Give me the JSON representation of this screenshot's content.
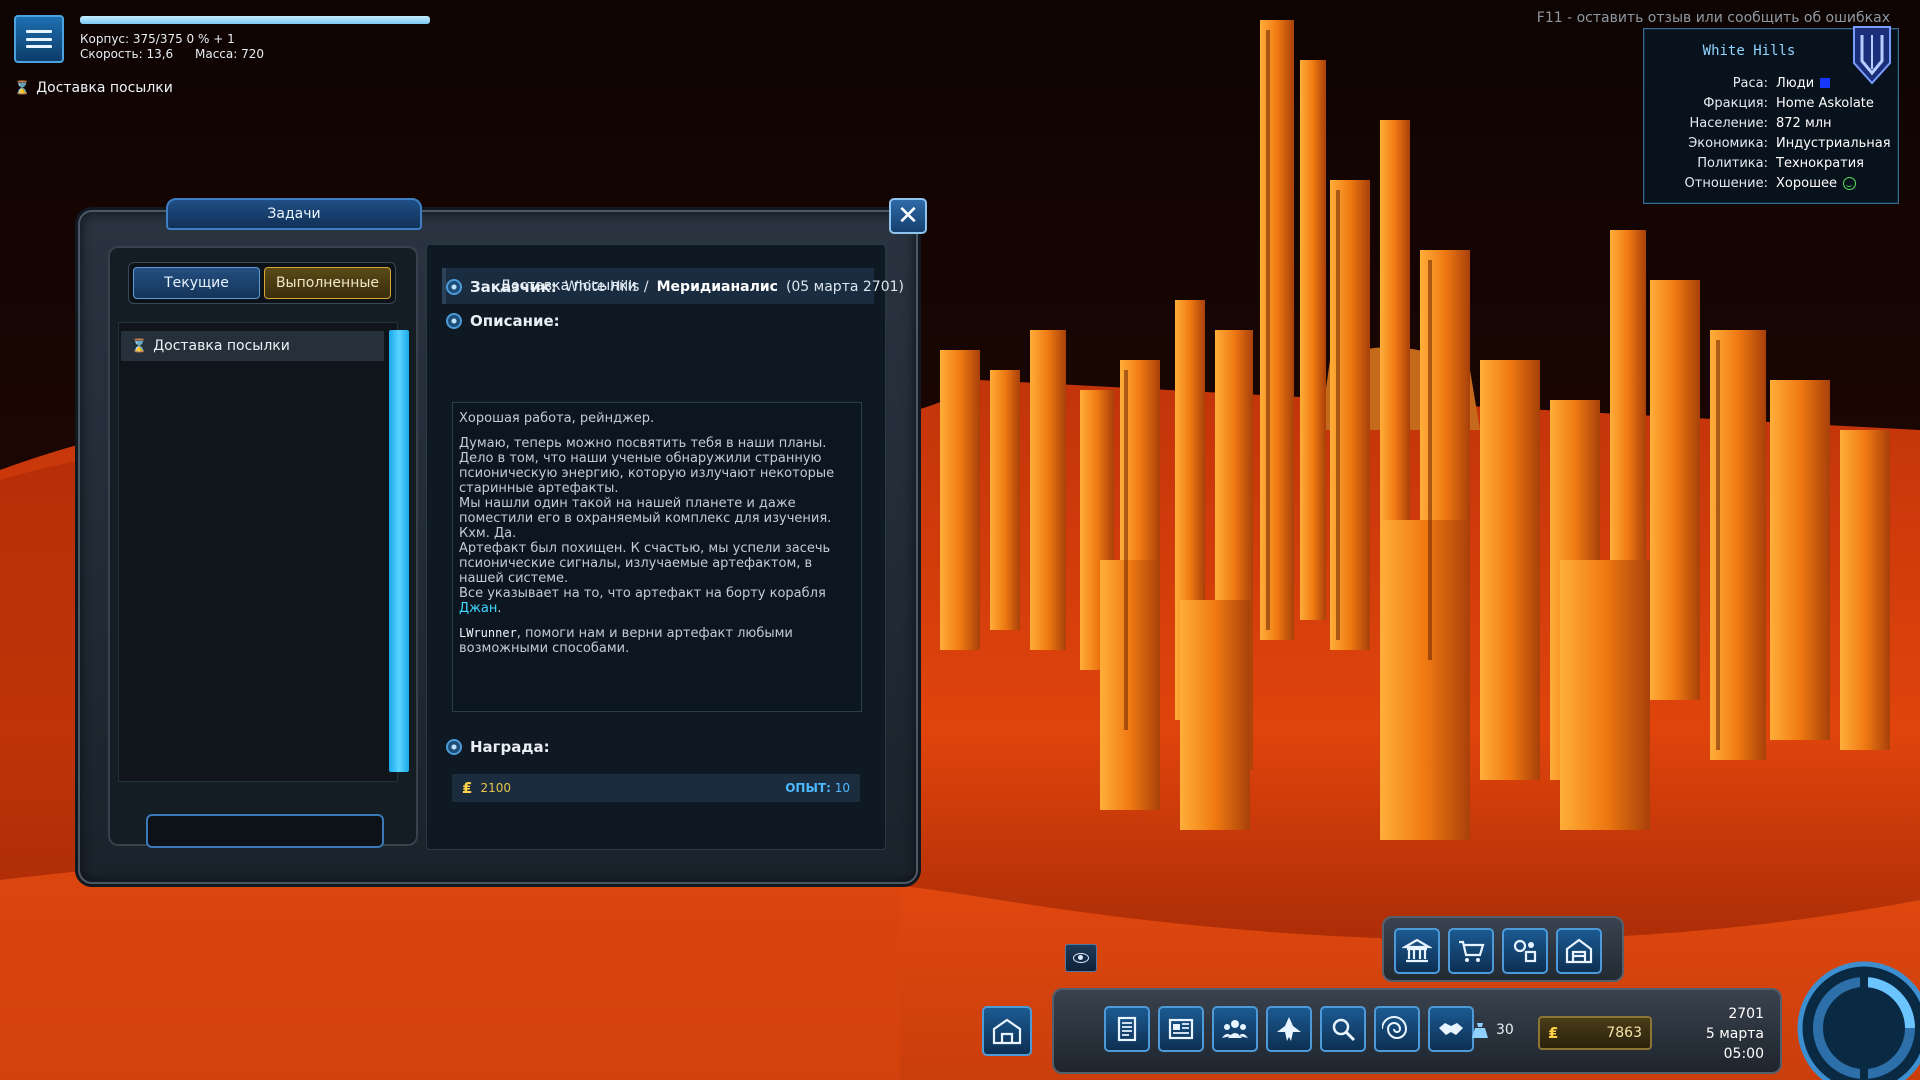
{
  "hud": {
    "hull_text": "Корпус: 375/375  0 % + 1",
    "speed_text": "Скорость: 13,6",
    "mass_text": "Масса: 720",
    "hull_fraction": 1.0,
    "active_quest": "Доставка посылки"
  },
  "feedback_hint": "F11 - оставить отзыв или сообщить об ошибках",
  "planet": {
    "name": "White Hills",
    "rows": [
      {
        "key": "Раса:",
        "value": "Люди"
      },
      {
        "key": "Фракция:",
        "value": "Home Askolate"
      },
      {
        "key": "Население:",
        "value": "872 млн"
      },
      {
        "key": "Экономика:",
        "value": "Индустриальная"
      },
      {
        "key": "Политика:",
        "value": "Технократия"
      },
      {
        "key": "Отношение:",
        "value": "Хорошее"
      }
    ],
    "race_color": "#1436ff",
    "relation_color": "#55e05a"
  },
  "quest_window": {
    "title": "Задачи",
    "tabs": {
      "current": "Текущие",
      "done": "Выполненные"
    },
    "list": [
      "Доставка посылки"
    ],
    "selected": {
      "title": "Доставка посылки",
      "client_label": "Заказчик:",
      "client_place": "White Hills /",
      "client_name": "Меридианалис",
      "client_date": "(05 марта 2701)",
      "description_label": "Описание:",
      "description": {
        "p1": "Хорошая работа, рейнджер.",
        "p2": "Думаю, теперь можно посвятить тебя в наши планы.",
        "p3": "Дело в том, что наши ученые обнаружили странную",
        "p4": "псионическую энергию, которую излучают некоторые",
        "p5": "старинные артефакты.",
        "p6": "Мы нашли один такой на нашей планете и даже",
        "p7": "поместили его в охраняемый комплекс для изучения.",
        "p8": "Кхм. Да.",
        "p9": "Артефакт был похищен. К счастью, мы успели засечь",
        "p10": "псионические сигналы, излучаемые артефактом, в",
        "p11": "нашей системе.",
        "p12": "Все указывает на то, что артефакт на борту корабля",
        "ship_name": "Джан",
        "ship_suffix": ".",
        "player_name": "LWrunner",
        "p13": ", помоги нам и верни артефакт любыми",
        "p14": "возможными способами."
      },
      "reward_label": "Награда:",
      "reward_money": "2100",
      "reward_xp_label": "ОПЫТ:",
      "reward_xp": "10"
    }
  },
  "bottom_hud": {
    "cargo": "30",
    "credits": "7863",
    "year": "2701",
    "date": "5 марта",
    "time": "05:00",
    "top_buttons": [
      "bank-icon",
      "shop-icon",
      "equipment-icon",
      "hangar-icon"
    ],
    "main_buttons": [
      "journal-icon",
      "news-icon",
      "crew-icon",
      "ship-icon",
      "search-icon",
      "galaxy-icon",
      "diplomacy-icon"
    ]
  },
  "colors": {
    "accent_blue": "#4e9ad8",
    "highlight_cyan": "#41d7ff",
    "gold": "#ffd24a"
  }
}
